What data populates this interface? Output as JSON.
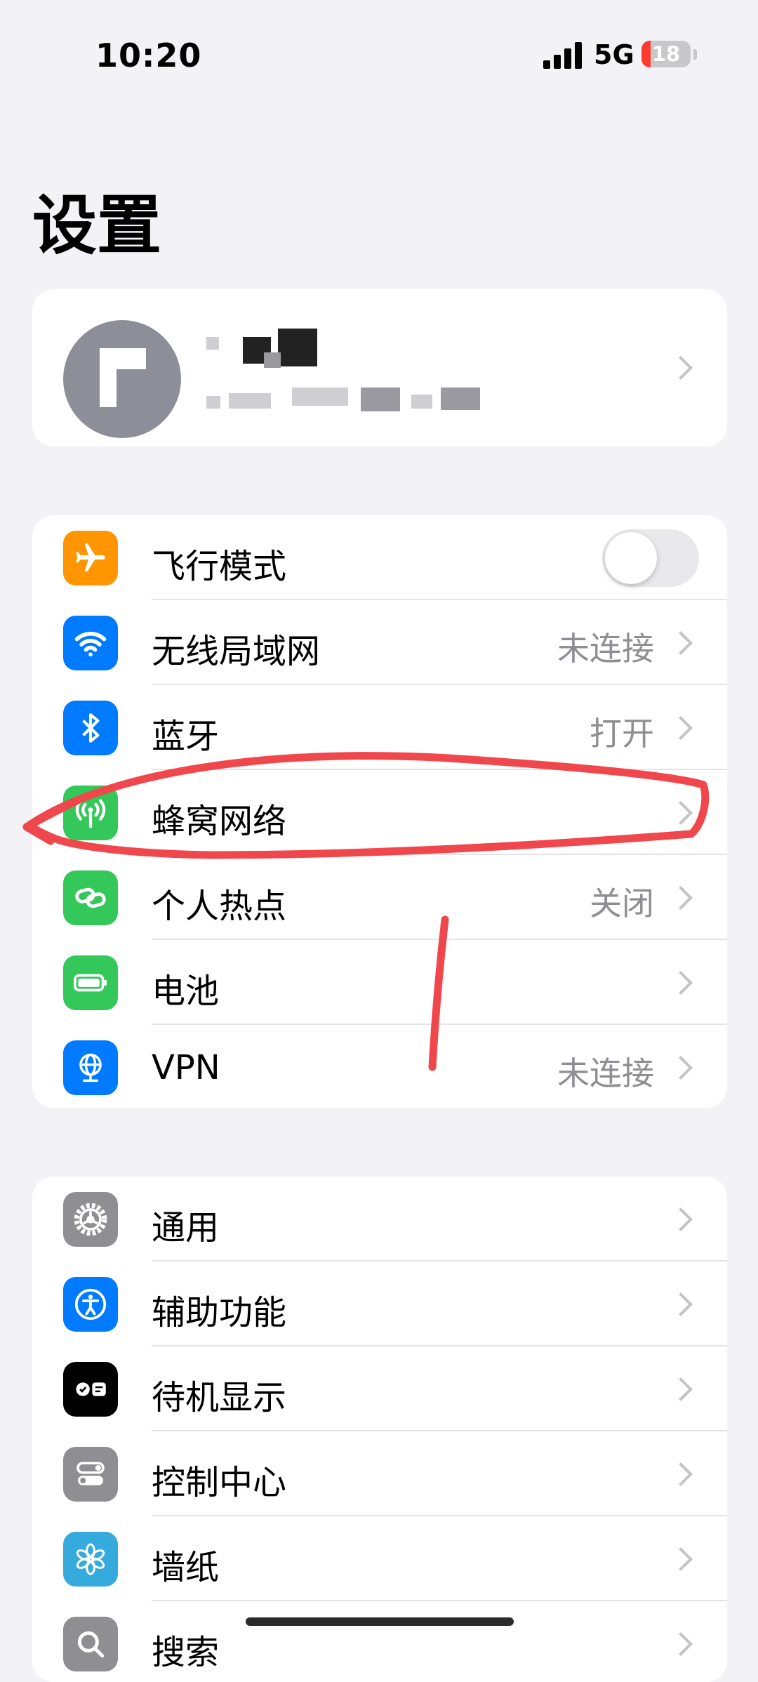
{
  "status_bar": {
    "time": "10:20",
    "network": "5G",
    "battery": "18",
    "battery_level": 18,
    "icon": "cellular-signal-icon"
  },
  "title": "设置",
  "profile": {
    "icon": "avatar"
  },
  "group1": [
    {
      "label": "飞行模式",
      "value": "",
      "icon": "airplane-icon",
      "color": "#ff9500",
      "toggle": true,
      "on": false
    },
    {
      "label": "无线局域网",
      "value": "未连接",
      "icon": "wifi-icon",
      "color": "#007aff"
    },
    {
      "label": "蓝牙",
      "value": "打开",
      "icon": "bluetooth-icon",
      "color": "#007aff"
    },
    {
      "label": "蜂窝网络",
      "value": "",
      "icon": "cellular-antenna-icon",
      "color": "#34c759"
    },
    {
      "label": "个人热点",
      "value": "关闭",
      "icon": "hotspot-link-icon",
      "color": "#34c759"
    },
    {
      "label": "电池",
      "value": "",
      "icon": "battery-icon",
      "color": "#34c759"
    },
    {
      "label": "VPN",
      "value": "未连接",
      "icon": "vpn-globe-icon",
      "color": "#007aff"
    }
  ],
  "group2": [
    {
      "label": "通用",
      "icon": "gear-icon",
      "color": "#8e8e93"
    },
    {
      "label": "辅助功能",
      "icon": "accessibility-icon",
      "color": "#007aff"
    },
    {
      "label": "待机显示",
      "icon": "standby-icon",
      "color": "#000000"
    },
    {
      "label": "控制中心",
      "icon": "control-center-icon",
      "color": "#8e8e93"
    },
    {
      "label": "墙纸",
      "icon": "wallpaper-flower-icon",
      "color": "#35aadc"
    },
    {
      "label": "搜索",
      "icon": "search-icon",
      "color": "#8e8e93"
    }
  ],
  "annotation": {
    "color": "#f0474c"
  }
}
